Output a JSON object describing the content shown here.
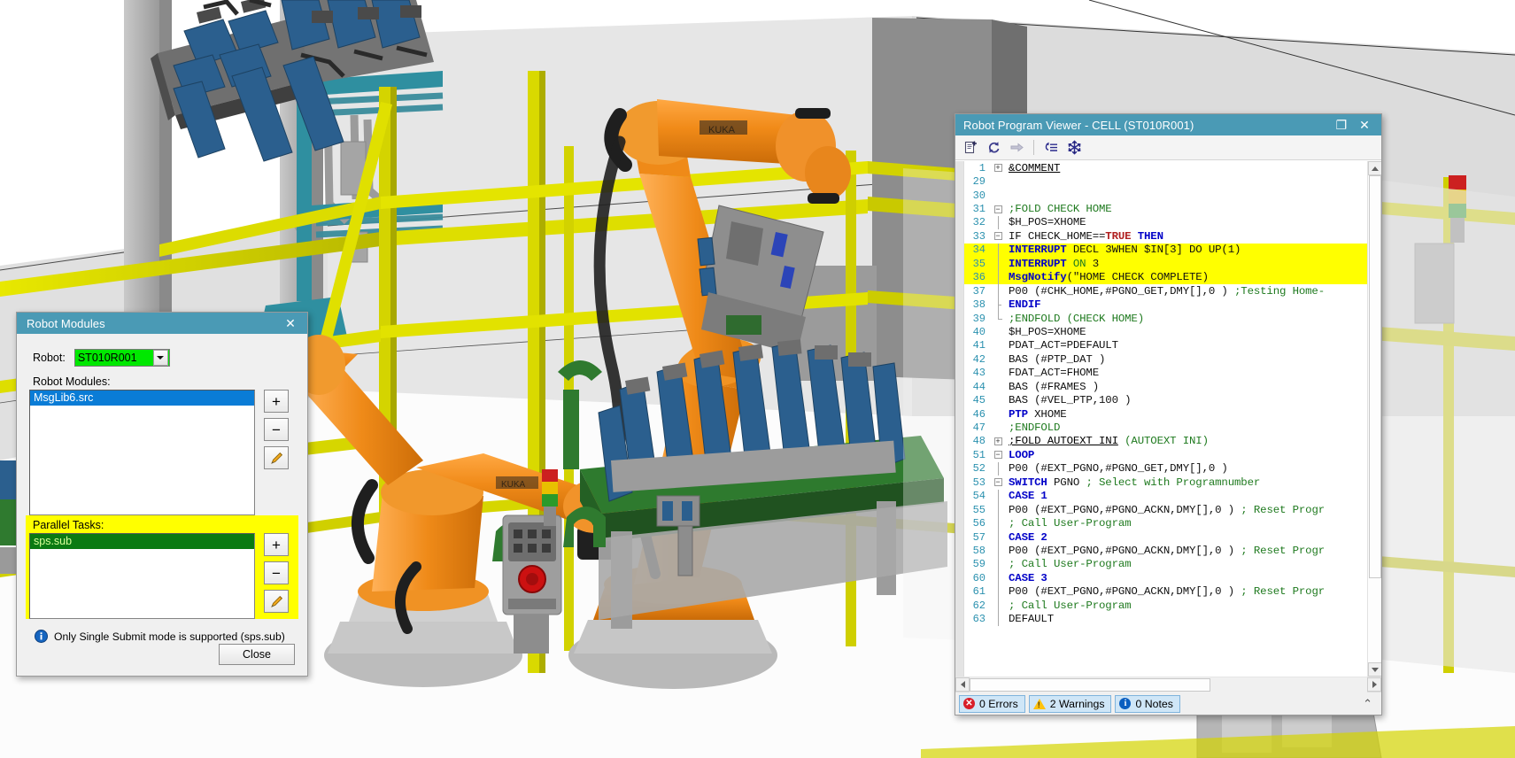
{
  "scene": {
    "name": "robot-cell-3d-view",
    "description": "KUKA robot simulation cell viewport",
    "colors": {
      "robot_orange": "#ef8015",
      "fence_yellow": "#d8d800",
      "fixture_blue": "#2b5f8e",
      "floor_gray": "#d8d8d8",
      "teal": "#2f8fa0"
    }
  },
  "robot_modules_dialog": {
    "title": "Robot Modules",
    "close_icon": "✕",
    "robot_label": "Robot:",
    "robot_value": "ST010R001",
    "modules_label": "Robot Modules:",
    "modules": [
      "MsgLib6.src"
    ],
    "parallel_label": "Parallel Tasks:",
    "parallel_tasks": [
      "sps.sub"
    ],
    "side_buttons": {
      "add": "+",
      "remove": "−",
      "edit": "✎"
    },
    "info_text": "Only Single Submit mode is supported (sps.sub)",
    "close_button": "Close"
  },
  "program_viewer": {
    "title": "Robot Program Viewer  - CELL (ST010R001)",
    "maximize_icon": "❐",
    "close_icon": "✕",
    "toolbar": [
      {
        "name": "new-document-icon",
        "tooltip": "New"
      },
      {
        "name": "refresh-icon",
        "tooltip": "Refresh"
      },
      {
        "name": "arrow-right-icon",
        "tooltip": "Go"
      },
      {
        "name": "collapse-outline-icon",
        "tooltip": "Outline"
      },
      {
        "name": "snowflake-icon",
        "tooltip": "Freeze"
      }
    ],
    "code_lines": [
      {
        "n": "1",
        "fold": "plus",
        "text": "&COMMENT",
        "style": "ul"
      },
      {
        "n": "29",
        "fold": "",
        "text": ""
      },
      {
        "n": "30",
        "fold": "",
        "text": ""
      },
      {
        "n": "31",
        "fold": "minus",
        "text": ";FOLD CHECK HOME",
        "style": "cm"
      },
      {
        "n": "32",
        "fold": "line",
        "text": "$H_POS=XHOME"
      },
      {
        "n": "33",
        "fold": "minus",
        "text": "IF CHECK_HOME==TRUE THEN",
        "style": "kw-if"
      },
      {
        "n": "34",
        "fold": "line",
        "text": "INTERRUPT DECL 3WHEN $IN[3] DO UP(1)",
        "hl": true,
        "style": "kw-int"
      },
      {
        "n": "35",
        "fold": "line",
        "text": "INTERRUPT ON 3",
        "hl": true,
        "style": "kw-int2"
      },
      {
        "n": "36",
        "fold": "line",
        "text": "MsgNotify(\"HOME CHECK COMPLETE)",
        "hl": true,
        "style": "msg"
      },
      {
        "n": "37",
        "fold": "line",
        "text": "P00 (#CHK_HOME,#PGNO_GET,DMY[],0 ) ;Testing Home-",
        "style": "p00cm"
      },
      {
        "n": "38",
        "fold": "tick",
        "text": "ENDIF",
        "style": "kw"
      },
      {
        "n": "39",
        "fold": "end",
        "text": ";ENDFOLD (CHECK HOME)",
        "style": "cm"
      },
      {
        "n": "40",
        "fold": "",
        "text": "$H_POS=XHOME"
      },
      {
        "n": "41",
        "fold": "",
        "text": "PDAT_ACT=PDEFAULT"
      },
      {
        "n": "42",
        "fold": "",
        "text": "BAS (#PTP_DAT )"
      },
      {
        "n": "43",
        "fold": "",
        "text": "FDAT_ACT=FHOME"
      },
      {
        "n": "44",
        "fold": "",
        "text": "BAS (#FRAMES )"
      },
      {
        "n": "45",
        "fold": "",
        "text": "BAS (#VEL_PTP,100 )"
      },
      {
        "n": "46",
        "fold": "",
        "text": "PTP  XHOME",
        "style": "ptp"
      },
      {
        "n": "47",
        "fold": "",
        "text": ";ENDFOLD",
        "style": "cm"
      },
      {
        "n": "48",
        "fold": "plus",
        "text": ";FOLD AUTOEXT INI  (AUTOEXT INI)",
        "style": "fold48"
      },
      {
        "n": "51",
        "fold": "minus",
        "text": "LOOP",
        "style": "kw"
      },
      {
        "n": "52",
        "fold": "line",
        "text": "P00 (#EXT_PGNO,#PGNO_GET,DMY[],0 )"
      },
      {
        "n": "53",
        "fold": "minus",
        "text": "SWITCH  PGNO ; Select with Programnumber",
        "style": "switch"
      },
      {
        "n": "54",
        "fold": "line",
        "text": "CASE 1",
        "style": "kw"
      },
      {
        "n": "55",
        "fold": "line",
        "text": "P00 (#EXT_PGNO,#PGNO_ACKN,DMY[],0 ) ; Reset Progr",
        "style": "p00cm"
      },
      {
        "n": "56",
        "fold": "line",
        "text": "; Call User-Program",
        "style": "cm"
      },
      {
        "n": "57",
        "fold": "line",
        "text": "CASE 2",
        "style": "kw"
      },
      {
        "n": "58",
        "fold": "line",
        "text": "P00 (#EXT_PGNO,#PGNO_ACKN,DMY[],0 ) ; Reset Progr",
        "style": "p00cm"
      },
      {
        "n": "59",
        "fold": "line",
        "text": "; Call User-Program",
        "style": "cm"
      },
      {
        "n": "60",
        "fold": "line",
        "text": "CASE 3",
        "style": "kw"
      },
      {
        "n": "61",
        "fold": "line",
        "text": "P00 (#EXT_PGNO,#PGNO_ACKN,DMY[],0 ) ; Reset Progr",
        "style": "p00cm"
      },
      {
        "n": "62",
        "fold": "line",
        "text": "; Call User-Program",
        "style": "cm"
      },
      {
        "n": "63",
        "fold": "line",
        "text": "DEFAULT",
        "style": "plain"
      }
    ],
    "status": {
      "errors": "0 Errors",
      "warnings": "2 Warnings",
      "notes": "0 Notes",
      "collapse_icon": "⌃"
    }
  },
  "colors": {
    "title_bar": "#4a9ab5",
    "highlight_yellow": "#ffff00",
    "selection_blue": "#0a7cd6",
    "selection_green": "#0a7a12",
    "combo_green": "#00e800",
    "status_chip": "#cfe6f7"
  }
}
